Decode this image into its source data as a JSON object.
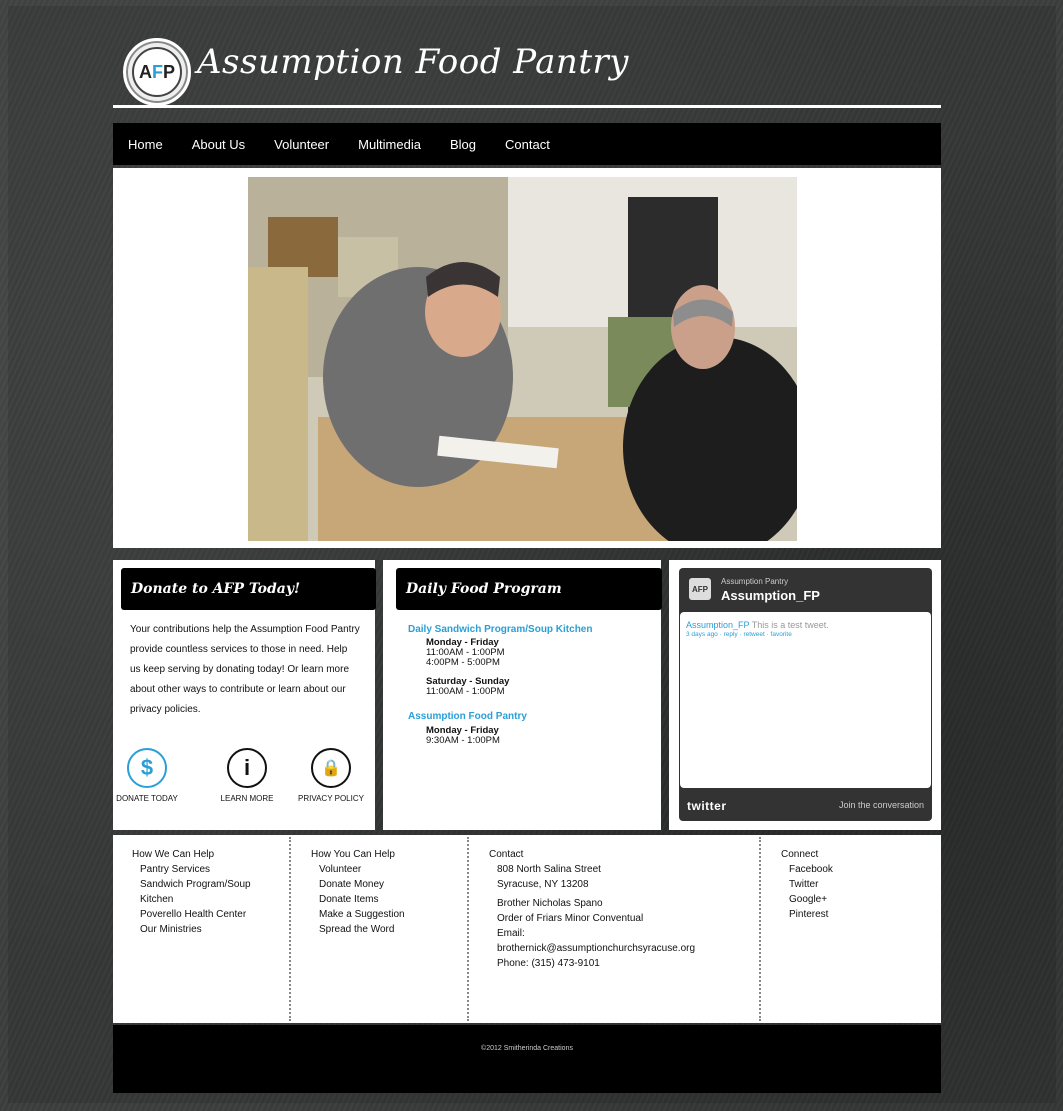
{
  "site": {
    "logo_text": "AFP",
    "title": "Assumption Food Pantry"
  },
  "nav": [
    "Home",
    "About Us",
    "Volunteer",
    "Multimedia",
    "Blog",
    "Contact"
  ],
  "donate": {
    "title": "Donate to AFP Today!",
    "text": "Your contributions help the Assumption Food Pantry provide countless services to those in need. Help us keep serving by donating today! Or learn more about other ways to contribute or learn about our privacy policies.",
    "icons": [
      {
        "label": "DONATE TODAY",
        "icon": "dollar-icon",
        "glyph": "$"
      },
      {
        "label": "LEARN MORE",
        "icon": "info-icon",
        "glyph": "i"
      },
      {
        "label": "PRIVACY POLICY",
        "icon": "lock-icon",
        "glyph": "🔒"
      }
    ]
  },
  "daily": {
    "title": "Daily Food Program",
    "program1": "Daily Sandwich Program/Soup Kitchen",
    "p1_weekday_label": "Monday - Friday",
    "p1_weekday_time1": "11:00AM - 1:00PM",
    "p1_weekday_time2": "4:00PM - 5:00PM",
    "p1_weekend_label": "Saturday - Sunday",
    "p1_weekend_time": "11:00AM - 1:00PM",
    "program2": "Assumption Food Pantry",
    "p2_label": "Monday - Friday",
    "p2_time": "9:30AM - 1:00PM"
  },
  "twitter": {
    "display_name": "Assumption Pantry",
    "handle": "Assumption_FP",
    "tweet_user": "Assumption_FP",
    "tweet_text": "This is a test tweet.",
    "tweet_meta": "3 days ago · reply · retweet · favorite",
    "logo": "twitter",
    "join": "Join the conversation"
  },
  "footer": {
    "col1": {
      "heading": "How We Can Help",
      "items": [
        "Pantry Services",
        "Sandwich Program/Soup Kitchen",
        "Poverello Health Center",
        "Our Ministries"
      ]
    },
    "col2": {
      "heading": "How You Can Help",
      "items": [
        "Volunteer",
        "Donate Money",
        "Donate Items",
        "Make a Suggestion",
        "Spread the Word"
      ]
    },
    "col3": {
      "heading": "Contact",
      "address1": "808 North Salina Street",
      "address2": "Syracuse, NY 13208",
      "contact_name": "Brother Nicholas Spano",
      "order": "Order of Friars Minor Conventual",
      "email_label": "Email:",
      "email": "brothernick@assumptionchurchsyracuse.org",
      "phone": "Phone: (315) 473-9101"
    },
    "col4": {
      "heading": "Connect",
      "items": [
        "Facebook",
        "Twitter",
        "Google+",
        "Pinterest"
      ]
    }
  },
  "copyright": "©2012 Smitherinda Creations",
  "colors": {
    "accent": "#2a9fd6",
    "nav_bg": "#000000",
    "background": "#3c3f3e"
  }
}
